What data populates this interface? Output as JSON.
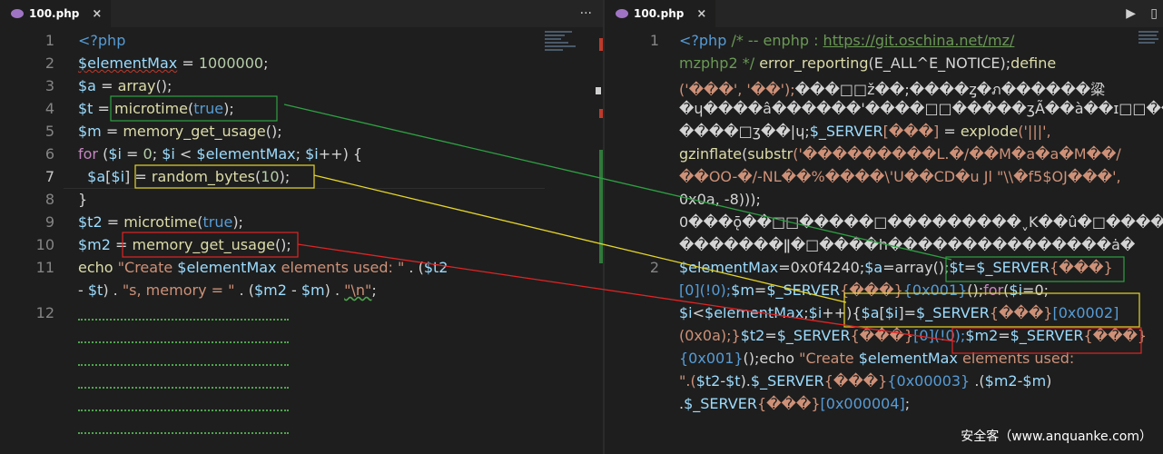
{
  "left": {
    "tab": {
      "label": "100.php",
      "close": "×"
    },
    "actions": {
      "more": "···"
    },
    "line_numbers": [
      "1",
      "2",
      "3",
      "4",
      "5",
      "6",
      "7",
      "8",
      "9",
      "10",
      "11",
      "",
      "12"
    ],
    "code": [
      [
        {
          "t": "<?php",
          "c": "tag"
        }
      ],
      [
        {
          "t": "$elementMax",
          "c": "var squig"
        },
        {
          "t": " = ",
          "c": "pun"
        },
        {
          "t": "1000000",
          "c": "num"
        },
        {
          "t": ";",
          "c": "pun"
        }
      ],
      [
        {
          "t": "$a",
          "c": "var"
        },
        {
          "t": " = ",
          "c": "pun"
        },
        {
          "t": "array",
          "c": "fn"
        },
        {
          "t": "();",
          "c": "pun"
        }
      ],
      [
        {
          "t": "$t",
          "c": "var"
        },
        {
          "t": " = ",
          "c": "pun"
        },
        {
          "t": "microtime",
          "c": "fn"
        },
        {
          "t": "(",
          "c": "pun"
        },
        {
          "t": "true",
          "c": "kw"
        },
        {
          "t": ");",
          "c": "pun"
        }
      ],
      [
        {
          "t": "$m",
          "c": "var"
        },
        {
          "t": " = ",
          "c": "pun"
        },
        {
          "t": "memory_get_usage",
          "c": "fn"
        },
        {
          "t": "();",
          "c": "pun"
        }
      ],
      [
        {
          "t": "for",
          "c": "ctl"
        },
        {
          "t": " (",
          "c": "pun"
        },
        {
          "t": "$i",
          "c": "var"
        },
        {
          "t": " = ",
          "c": "pun"
        },
        {
          "t": "0",
          "c": "num"
        },
        {
          "t": "; ",
          "c": "pun"
        },
        {
          "t": "$i",
          "c": "var"
        },
        {
          "t": " < ",
          "c": "pun"
        },
        {
          "t": "$elementMax",
          "c": "var"
        },
        {
          "t": "; ",
          "c": "pun"
        },
        {
          "t": "$i",
          "c": "var"
        },
        {
          "t": "++) {",
          "c": "pun"
        }
      ],
      [
        {
          "t": "  ",
          "c": "pun"
        },
        {
          "t": "$a",
          "c": "var"
        },
        {
          "t": "[",
          "c": "pun"
        },
        {
          "t": "$i",
          "c": "var"
        },
        {
          "t": "] = ",
          "c": "pun"
        },
        {
          "t": "random_bytes",
          "c": "fn"
        },
        {
          "t": "(",
          "c": "pun"
        },
        {
          "t": "10",
          "c": "num"
        },
        {
          "t": ");",
          "c": "pun"
        }
      ],
      [
        {
          "t": "}",
          "c": "pun"
        }
      ],
      [
        {
          "t": "$t2",
          "c": "var"
        },
        {
          "t": " = ",
          "c": "pun"
        },
        {
          "t": "microtime",
          "c": "fn"
        },
        {
          "t": "(",
          "c": "pun"
        },
        {
          "t": "true",
          "c": "kw"
        },
        {
          "t": ");",
          "c": "pun"
        }
      ],
      [
        {
          "t": "$m2",
          "c": "var"
        },
        {
          "t": " = ",
          "c": "pun"
        },
        {
          "t": "memory_get_usage",
          "c": "fn"
        },
        {
          "t": "();",
          "c": "pun"
        }
      ],
      [
        {
          "t": "echo",
          "c": "fn"
        },
        {
          "t": " \"Create ",
          "c": "str"
        },
        {
          "t": "$elementMax",
          "c": "var"
        },
        {
          "t": " elements used: \"",
          "c": "str"
        },
        {
          "t": " . (",
          "c": "pun"
        },
        {
          "t": "$t2",
          "c": "var"
        }
      ],
      [
        {
          "t": "- ",
          "c": "pun"
        },
        {
          "t": "$t",
          "c": "var"
        },
        {
          "t": ") . ",
          "c": "pun"
        },
        {
          "t": "\"s, memory = \"",
          "c": "str"
        },
        {
          "t": " . (",
          "c": "pun"
        },
        {
          "t": "$m2",
          "c": "var"
        },
        {
          "t": " - ",
          "c": "pun"
        },
        {
          "t": "$m",
          "c": "var"
        },
        {
          "t": ") . ",
          "c": "pun"
        },
        {
          "t": "\"\\n\"",
          "c": "str squig-g"
        },
        {
          "t": ";",
          "c": "pun"
        }
      ],
      []
    ]
  },
  "right": {
    "tab": {
      "label": "100.php",
      "close": "×"
    },
    "actions": {
      "run": "▶",
      "split": "▯"
    },
    "line_numbers": [
      {
        "n": "1",
        "row": 0
      },
      {
        "n": "2",
        "row": 10
      }
    ],
    "code": [
      [
        {
          "t": "<?php ",
          "c": "tag"
        },
        {
          "t": "/* -- enphp : ",
          "c": "cm"
        },
        {
          "t": "https://git.oschina.net/mz/",
          "c": "url"
        }
      ],
      [
        {
          "t": "mzphp2 */ ",
          "c": "cm"
        },
        {
          "t": "error_reporting",
          "c": "fn"
        },
        {
          "t": "(E_ALL^E_NOTICE);",
          "c": "txt"
        },
        {
          "t": "define",
          "c": "fn"
        }
      ],
      [
        {
          "t": "('���', '��');",
          "c": "str"
        },
        {
          "t": "���□□ž��;����ȥ�ภ������粱",
          "c": "txt"
        }
      ],
      [
        {
          "t": "�ɥ����â������'����□□�����ʒÃ��à��ɪ□□��",
          "c": "txt"
        }
      ],
      [
        {
          "t": "����□ʒ��|ɥ;",
          "c": "txt"
        },
        {
          "t": "$_SERVER",
          "c": "var"
        },
        {
          "t": "[���]",
          "c": "str"
        },
        {
          "t": " = ",
          "c": "pun"
        },
        {
          "t": "explode",
          "c": "fn"
        },
        {
          "t": "('|||',",
          "c": "str"
        }
      ],
      [
        {
          "t": "gzinflate",
          "c": "fn"
        },
        {
          "t": "(",
          "c": "pun"
        },
        {
          "t": "substr",
          "c": "fn"
        },
        {
          "t": "('���������L.�/��M�a�a�M��/",
          "c": "str"
        }
      ],
      [
        {
          "t": "��OO-�/-NL��%����\\'U��CD�u Jl \"\\\\�f5$OJ���',",
          "c": "str"
        }
      ],
      [
        {
          "t": "0x0a, -8)));",
          "c": "txt"
        }
      ],
      [
        {
          "t": "0���ǭ��□□�����□���������ˬK��û�□������",
          "c": "txt"
        }
      ],
      [
        {
          "t": "�������ǁ�□����h���������������ȧ�",
          "c": "txt"
        }
      ],
      [
        {
          "t": "$elementMax",
          "c": "var"
        },
        {
          "t": "=0x0f4240;",
          "c": "txt"
        },
        {
          "t": "$a",
          "c": "var"
        },
        {
          "t": "=array();",
          "c": "txt"
        },
        {
          "t": "$t",
          "c": "var"
        },
        {
          "t": "=",
          "c": "pun"
        },
        {
          "t": "$_SERVER",
          "c": "var"
        },
        {
          "t": "{���}",
          "c": "str"
        }
      ],
      [
        {
          "t": "[0](!0);",
          "c": "kw"
        },
        {
          "t": "$m",
          "c": "var"
        },
        {
          "t": "=",
          "c": "pun"
        },
        {
          "t": "$_SERVER",
          "c": "var"
        },
        {
          "t": "{���}",
          "c": "str"
        },
        {
          "t": "{0x001}",
          "c": "kw"
        },
        {
          "t": "();",
          "c": "pun"
        },
        {
          "t": "for",
          "c": "ctl"
        },
        {
          "t": "(",
          "c": "pun"
        },
        {
          "t": "$i",
          "c": "var"
        },
        {
          "t": "=0;",
          "c": "pun"
        }
      ],
      [
        {
          "t": "$i",
          "c": "var"
        },
        {
          "t": "<",
          "c": "pun"
        },
        {
          "t": "$elementMax",
          "c": "var"
        },
        {
          "t": ";",
          "c": "pun"
        },
        {
          "t": "$i",
          "c": "var"
        },
        {
          "t": "++){",
          "c": "pun"
        },
        {
          "t": "$a",
          "c": "var"
        },
        {
          "t": "[",
          "c": "pun"
        },
        {
          "t": "$i",
          "c": "var"
        },
        {
          "t": "]=",
          "c": "pun"
        },
        {
          "t": "$_SERVER",
          "c": "var"
        },
        {
          "t": "{���}",
          "c": "str"
        },
        {
          "t": "[0x0002]",
          "c": "kw"
        }
      ],
      [
        {
          "t": "(0x0a);}",
          "c": "str"
        },
        {
          "t": "$t2",
          "c": "var"
        },
        {
          "t": "=",
          "c": "pun"
        },
        {
          "t": "$_SERVER",
          "c": "var"
        },
        {
          "t": "{���}",
          "c": "str"
        },
        {
          "t": "[0](!0);",
          "c": "kw"
        },
        {
          "t": "$m2",
          "c": "var"
        },
        {
          "t": "=",
          "c": "pun"
        },
        {
          "t": "$_SERVER",
          "c": "var"
        },
        {
          "t": "{���}",
          "c": "str"
        }
      ],
      [
        {
          "t": "{0x001}",
          "c": "kw"
        },
        {
          "t": "();echo ",
          "c": "txt"
        },
        {
          "t": "\"Create ",
          "c": "str"
        },
        {
          "t": "$elementMax",
          "c": "var"
        },
        {
          "t": " elements used:",
          "c": "str"
        }
      ],
      [
        {
          "t": "\".(",
          "c": "str"
        },
        {
          "t": "$t2",
          "c": "var"
        },
        {
          "t": "-",
          "c": "pun"
        },
        {
          "t": "$t",
          "c": "var"
        },
        {
          "t": ").",
          "c": "pun"
        },
        {
          "t": "$_SERVER",
          "c": "var"
        },
        {
          "t": "{���}",
          "c": "str"
        },
        {
          "t": "{0x00003}",
          "c": "kw"
        },
        {
          "t": " .(",
          "c": "pun"
        },
        {
          "t": "$m2",
          "c": "var"
        },
        {
          "t": "-",
          "c": "pun"
        },
        {
          "t": "$m",
          "c": "var"
        },
        {
          "t": ")",
          "c": "pun"
        }
      ],
      [
        {
          "t": ".",
          "c": "pun"
        },
        {
          "t": "$_SERVER",
          "c": "var"
        },
        {
          "t": "{���}",
          "c": "str"
        },
        {
          "t": "[0x000004]",
          "c": "kw"
        },
        {
          "t": ";",
          "c": "pun"
        }
      ]
    ]
  },
  "watermark": "安全客（www.anquanke.com）",
  "colors": {
    "green": "#2ea043",
    "yellow": "#e5d62a",
    "red": "#e02424",
    "bg": "#1e1e1e"
  }
}
